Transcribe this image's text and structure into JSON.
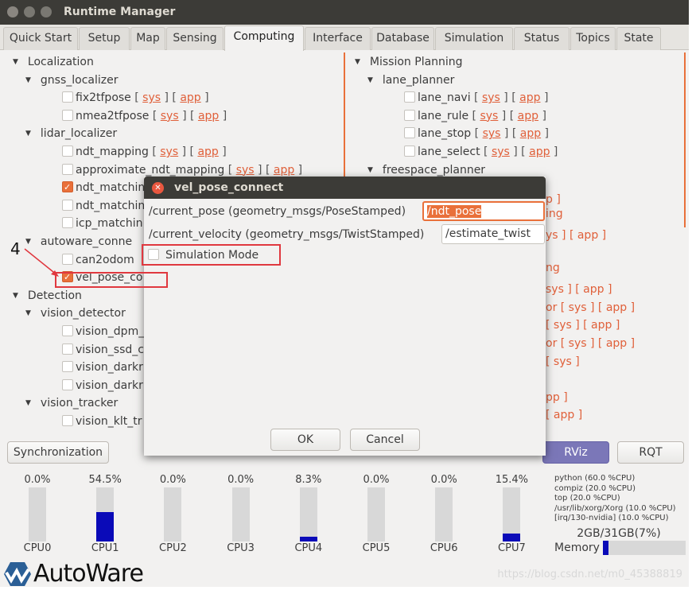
{
  "window": {
    "title": "Runtime Manager"
  },
  "tabs": [
    "Quick Start",
    "Setup",
    "Map",
    "Sensing",
    "Computing",
    "Interface",
    "Database",
    "Simulation",
    "Status",
    "Topics",
    "State"
  ],
  "active_tab": "Computing",
  "left_tree": [
    {
      "level": 0,
      "label": "Localization",
      "type": "group"
    },
    {
      "level": 1,
      "label": "gnss_localizer",
      "type": "group"
    },
    {
      "level": 2,
      "label": "fix2tfpose",
      "checked": false,
      "links": [
        "sys",
        "app"
      ]
    },
    {
      "level": 2,
      "label": "nmea2tfpose",
      "checked": false,
      "links": [
        "sys",
        "app"
      ]
    },
    {
      "level": 1,
      "label": "lidar_localizer",
      "type": "group"
    },
    {
      "level": 2,
      "label": "ndt_mapping",
      "checked": false,
      "links": [
        "sys",
        "app"
      ]
    },
    {
      "level": 2,
      "label": "approximate_ndt_mapping",
      "checked": false,
      "links": [
        "sys",
        "app"
      ]
    },
    {
      "level": 2,
      "label": "ndt_matchin",
      "checked": true
    },
    {
      "level": 2,
      "label": "ndt_matchin",
      "checked": false
    },
    {
      "level": 2,
      "label": "icp_matchin",
      "checked": false
    },
    {
      "level": 1,
      "label": "autoware_conne",
      "type": "group"
    },
    {
      "level": 2,
      "label": "can2odom",
      "checked": false
    },
    {
      "level": 2,
      "label": "vel_pose_co",
      "checked": true
    },
    {
      "level": 0,
      "label": "Detection",
      "type": "group"
    },
    {
      "level": 1,
      "label": "vision_detector",
      "type": "group"
    },
    {
      "level": 2,
      "label": "vision_dpm_",
      "checked": false
    },
    {
      "level": 2,
      "label": "vision_ssd_c",
      "checked": false
    },
    {
      "level": 2,
      "label": "vision_darkr",
      "checked": false
    },
    {
      "level": 2,
      "label": "vision_darkr",
      "checked": false
    },
    {
      "level": 1,
      "label": "vision_tracker",
      "type": "group"
    },
    {
      "level": 2,
      "label": "vision_klt_tr",
      "checked": false
    }
  ],
  "right_tree": [
    {
      "level": 0,
      "label": "Mission Planning",
      "type": "group"
    },
    {
      "level": 1,
      "label": "lane_planner",
      "type": "group"
    },
    {
      "level": 2,
      "label": "lane_navi",
      "checked": false,
      "links": [
        "sys",
        "app"
      ]
    },
    {
      "level": 2,
      "label": "lane_rule",
      "checked": false,
      "links": [
        "sys",
        "app"
      ]
    },
    {
      "level": 2,
      "label": "lane_stop",
      "checked": false,
      "links": [
        "sys",
        "app"
      ]
    },
    {
      "level": 2,
      "label": "lane_select",
      "checked": false,
      "links": [
        "sys",
        "app"
      ]
    },
    {
      "level": 1,
      "label": "freespace_planner",
      "type": "group"
    }
  ],
  "right_fragments": [
    "p ]",
    "ing",
    "ys ] [ app ]",
    "ng",
    "sys ] [ app ]",
    "or [ sys ] [ app ]",
    "[ sys ] [ app ]",
    "or [ sys ] [ app ]",
    "[ sys ]",
    "pp ]",
    "[ app ]"
  ],
  "buttons": {
    "synchronization": "Synchronization",
    "rviz": "RViz",
    "rqt": "RQT"
  },
  "dialog": {
    "title": "vel_pose_connect",
    "pose_label": "/current_pose (geometry_msgs/PoseStamped)",
    "pose_value": "/ndt_pose",
    "velocity_label": "/current_velocity (geometry_msgs/TwistStamped)",
    "velocity_value": "/estimate_twist",
    "simulation_mode": "Simulation Mode",
    "simulation_checked": false,
    "ok": "OK",
    "cancel": "Cancel"
  },
  "annotation": "4",
  "cpus": [
    {
      "label": "CPU0",
      "value": "0.0%",
      "pct": 0
    },
    {
      "label": "CPU1",
      "value": "54.5%",
      "pct": 54.5
    },
    {
      "label": "CPU2",
      "value": "0.0%",
      "pct": 0
    },
    {
      "label": "CPU3",
      "value": "0.0%",
      "pct": 0
    },
    {
      "label": "CPU4",
      "value": "8.3%",
      "pct": 8.3
    },
    {
      "label": "CPU5",
      "value": "0.0%",
      "pct": 0
    },
    {
      "label": "CPU6",
      "value": "0.0%",
      "pct": 0
    },
    {
      "label": "CPU7",
      "value": "15.4%",
      "pct": 15.4
    }
  ],
  "processes": [
    "python (60.0 %CPU)",
    "compiz (20.0 %CPU)",
    "top (20.0 %CPU)",
    "/usr/lib/xorg/Xorg (10.0 %CPU)",
    "[irq/130-nvidia] (10.0 %CPU)"
  ],
  "memory": {
    "text": "2GB/31GB(7%)",
    "label": "Memory",
    "pct": 7
  },
  "logo": "AutoWare",
  "watermark": "https://blog.csdn.net/m0_45388819",
  "colors": {
    "accent": "#e9703a",
    "link": "#e0603a",
    "bar": "#0a0ab8",
    "annotation": "#e0383f"
  }
}
